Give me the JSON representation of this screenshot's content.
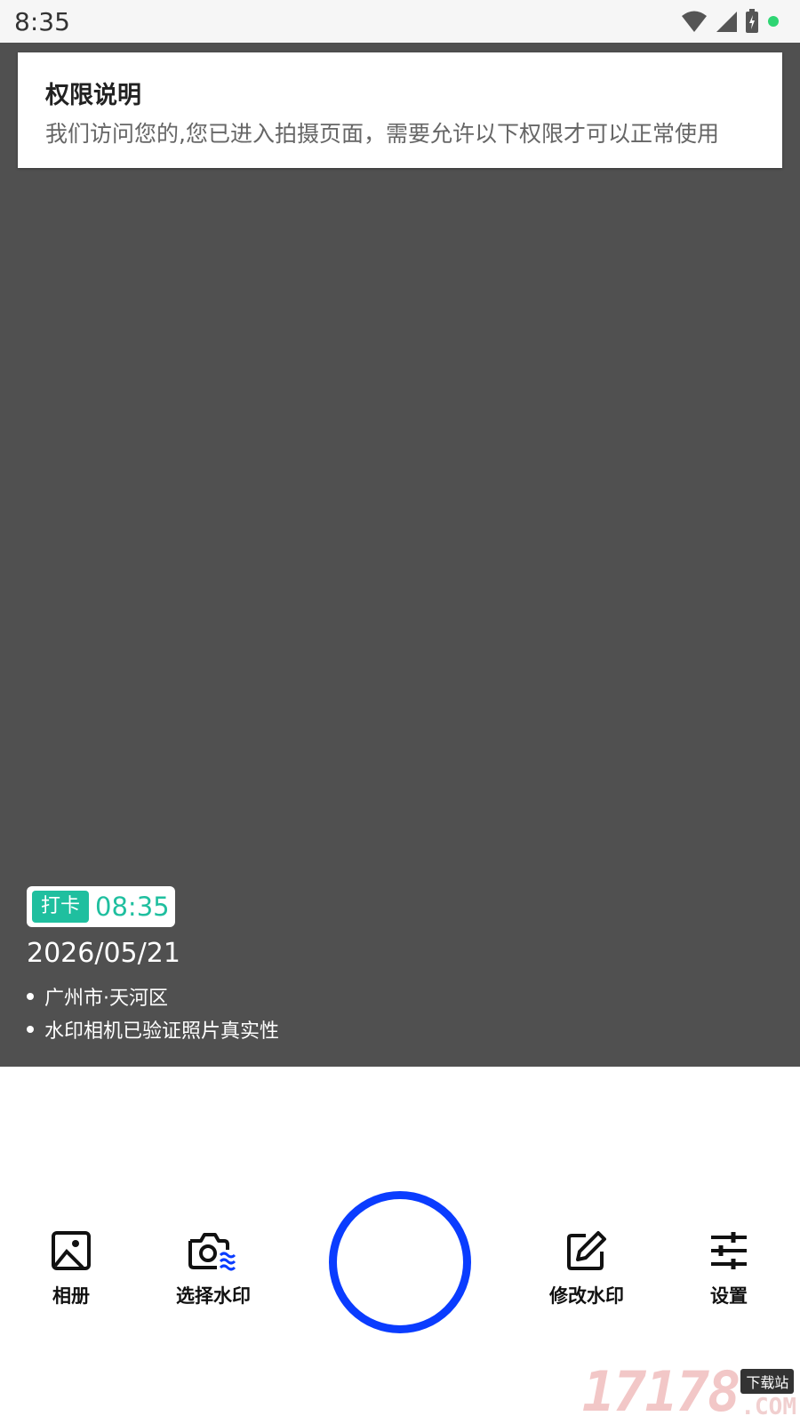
{
  "status_bar": {
    "time": "8:35",
    "icons": [
      "wifi-icon",
      "signal-icon",
      "battery-icon",
      "status-dot-icon"
    ],
    "dot_color": "#2ed573"
  },
  "permission": {
    "title": "权限说明",
    "body": "我们访问您的,您已进入拍摄页面，需要允许以下权限才可以正常使用"
  },
  "watermark": {
    "tag": "打卡",
    "time": "08:35",
    "date": "2026/05/21",
    "lines": [
      "广州市·天河区",
      "水印相机已验证照片真实性"
    ],
    "accent": "#1fbf9f"
  },
  "toolbar": {
    "album_label": "相册",
    "select_watermark_label": "选择水印",
    "edit_watermark_label": "修改水印",
    "settings_label": "设置",
    "shutter_color": "#0a3cff",
    "icons": [
      "image-icon",
      "camera-watermark-icon",
      "edit-icon",
      "sliders-icon"
    ]
  },
  "site_watermark": {
    "number": "17178",
    "download": "下载站",
    "suffix": ".COM"
  }
}
